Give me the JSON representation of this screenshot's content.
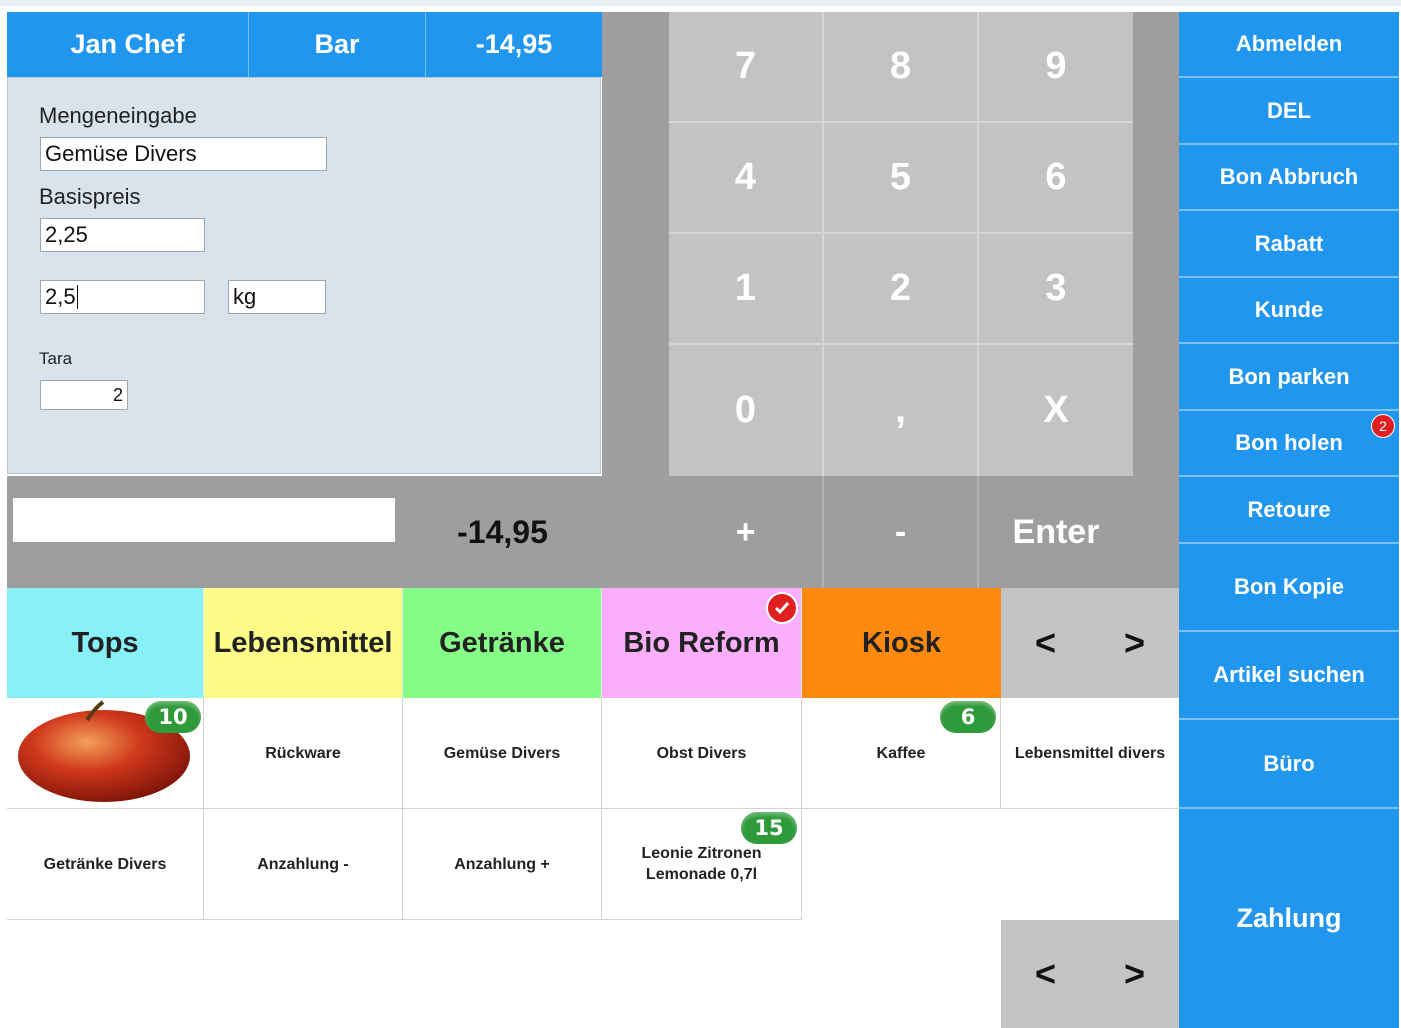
{
  "header": {
    "user": "Jan Chef",
    "payment": "Bar",
    "total": "-14,95"
  },
  "form": {
    "quantity_label": "Mengeneingabe",
    "article_value": "Gemüse Divers",
    "base_price_label": "Basispreis",
    "base_price_value": "2,25",
    "amount_value": "2,5",
    "unit_value": "kg",
    "tara_label": "Tara",
    "tara_value": "2"
  },
  "display": {
    "input_value": "",
    "sum": "-14,95"
  },
  "keypad": {
    "rows": [
      [
        "7",
        "8",
        "9"
      ],
      [
        "4",
        "5",
        "6"
      ],
      [
        "1",
        "2",
        "3"
      ],
      [
        "0",
        ",",
        "X"
      ]
    ],
    "ops": [
      "+",
      "-",
      "Enter"
    ]
  },
  "actions": {
    "logout": "Abmelden",
    "del": "DEL",
    "cancel_receipt": "Bon Abbruch",
    "discount": "Rabatt",
    "customer": "Kunde",
    "park_receipt": "Bon parken",
    "fetch_receipt": "Bon holen",
    "fetch_receipt_count": "2",
    "return": "Retoure",
    "copy_receipt": "Bon Kopie",
    "search_article": "Artikel suchen",
    "office": "Büro",
    "payment": "Zahlung"
  },
  "categories": [
    {
      "label": "Tops",
      "color": "#88f0f8"
    },
    {
      "label": "Lebensmittel",
      "color": "#fdfc88"
    },
    {
      "label": "Getränke",
      "color": "#86fd86"
    },
    {
      "label": "Bio Reform",
      "color": "#fbaefc"
    },
    {
      "label": "Kiosk",
      "color": "#fd8a0e"
    }
  ],
  "nav": {
    "prev": "<",
    "next": ">"
  },
  "products": {
    "apple_badge": "10",
    "r1": [
      "Rückware",
      "Gemüse Divers",
      "Obst Divers",
      "Kaffee",
      "Lebensmittel divers"
    ],
    "kaffee_badge": "6",
    "r2": [
      "Getränke Divers",
      "Anzahlung -",
      "Anzahlung +",
      "Leonie Zitronen Lemonade 0,7l"
    ],
    "leonie_badge": "15"
  },
  "colors": {
    "accent_blue": "#2196ee",
    "key_gray": "#c3c3c3",
    "dark_gray": "#9e9e9e"
  }
}
